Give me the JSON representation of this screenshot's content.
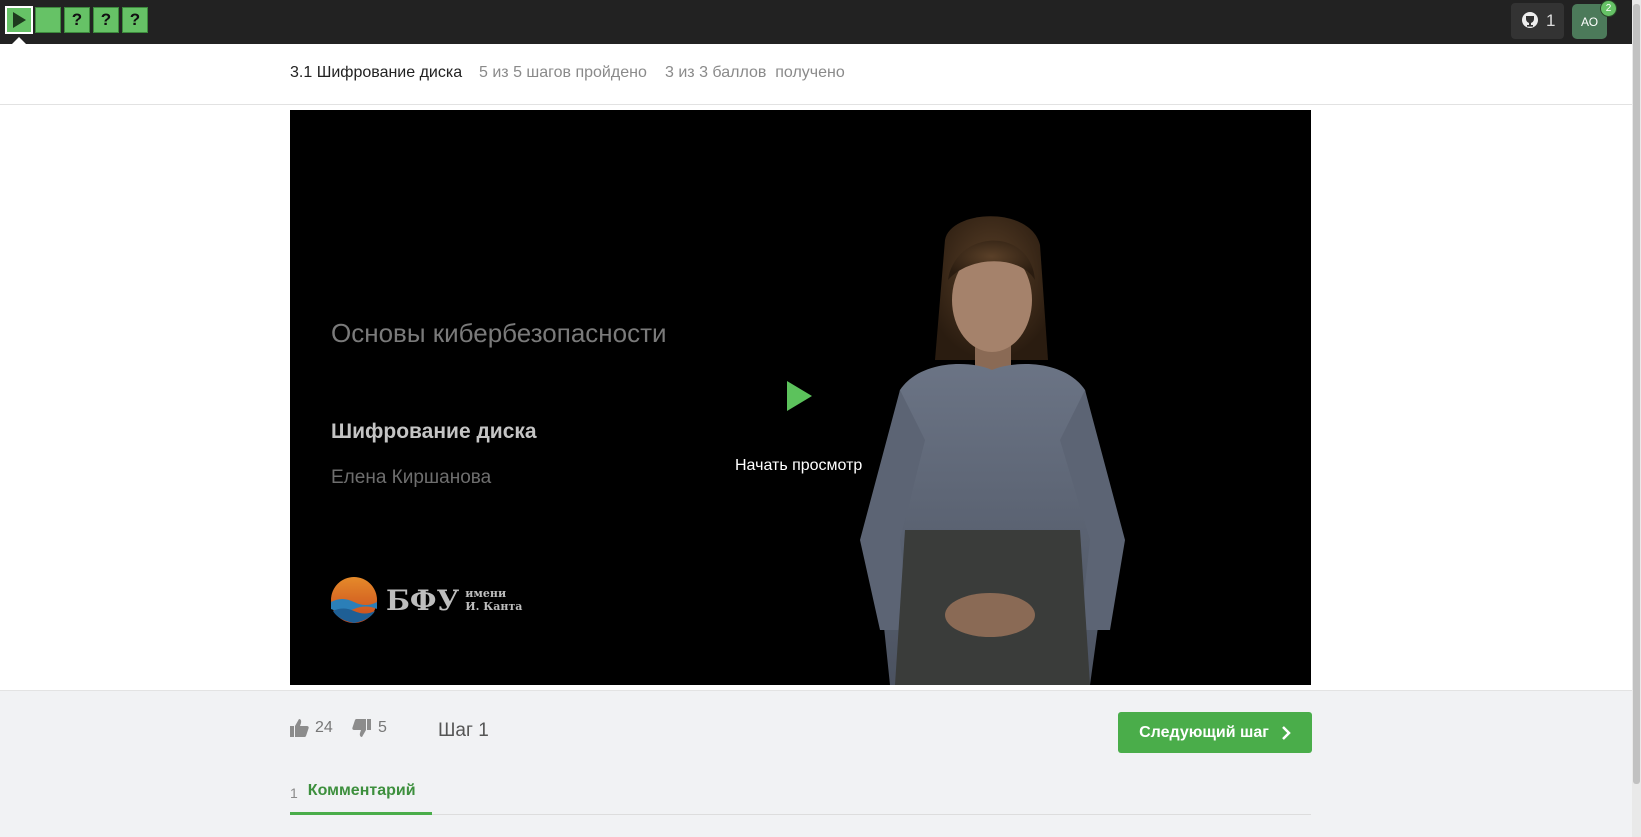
{
  "topbar": {
    "steps": [
      {
        "label": "",
        "kind": "video",
        "icon": "play-icon",
        "active": true
      },
      {
        "label": "",
        "kind": "text"
      },
      {
        "label": "?",
        "kind": "quiz"
      },
      {
        "label": "?",
        "kind": "quiz"
      },
      {
        "label": "?",
        "kind": "quiz"
      }
    ],
    "trophy_count": "1",
    "avatar_initials": "АО",
    "notification_count": "2"
  },
  "lesson": {
    "title": "3.1 Шифрование диска",
    "progress": "5 из 5 шагов пройдено",
    "score": "3 из 3 баллов  получено"
  },
  "video": {
    "course_title": "Основы кибербезопасности",
    "topic": "Шифрование диска",
    "author": "Елена Киршанова",
    "logo_text": "БФУ",
    "logo_sub_1": "имени",
    "logo_sub_2": "И. Канта",
    "play_label": "Начать просмотр"
  },
  "footer": {
    "likes": "24",
    "dislikes": "5",
    "step_label": "Шаг 1",
    "next_label": "Следующий шаг",
    "comments_count": "1",
    "comments_label": "Комментарий"
  },
  "colors": {
    "accent": "#4aad4a",
    "topbar": "#222222",
    "step_fill": "#66c266"
  }
}
